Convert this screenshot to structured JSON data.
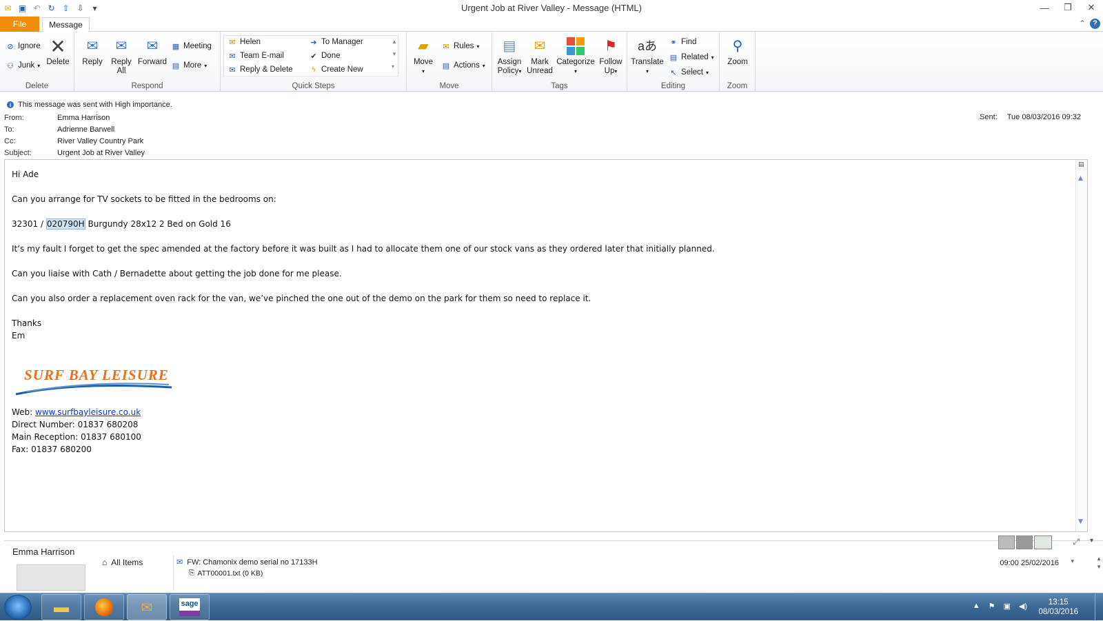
{
  "window": {
    "title": "Urgent Job at River Valley  -  Message (HTML)"
  },
  "tabs": {
    "file": "File",
    "message": "Message"
  },
  "ribbon": {
    "delete_group": {
      "label": "Delete",
      "ignore": "Ignore",
      "junk": "Junk",
      "delete": "Delete"
    },
    "respond_group": {
      "label": "Respond",
      "reply": "Reply",
      "reply_all_1": "Reply",
      "reply_all_2": "All",
      "forward": "Forward",
      "meeting": "Meeting",
      "more": "More"
    },
    "quicksteps_group": {
      "label": "Quick Steps",
      "items": [
        "Helen",
        "To Manager",
        "Team E-mail",
        "Done",
        "Reply & Delete",
        "Create New"
      ]
    },
    "move_group": {
      "label": "Move",
      "move": "Move",
      "rules": "Rules",
      "actions": "Actions"
    },
    "tags_group": {
      "label": "Tags",
      "assign_1": "Assign",
      "assign_2": "Policy",
      "mark_1": "Mark",
      "mark_2": "Unread",
      "categorize": "Categorize",
      "follow_1": "Follow",
      "follow_2": "Up"
    },
    "editing_group": {
      "label": "Editing",
      "translate": "Translate",
      "find": "Find",
      "related": "Related",
      "select": "Select"
    },
    "zoom_group": {
      "label": "Zoom",
      "zoom": "Zoom"
    }
  },
  "header": {
    "importance": "This message was sent with High importance.",
    "from_label": "From:",
    "from": "Emma Harrison",
    "to_label": "To:",
    "to": "Adrienne Barwell",
    "cc_label": "Cc:",
    "cc": "River Valley Country Park",
    "subject_label": "Subject:",
    "subject": "Urgent Job at River Valley",
    "sent_label": "Sent:",
    "sent": "Tue 08/03/2016 09:32"
  },
  "body": {
    "greeting": "Hi Ade",
    "line1": "Can you arrange for TV sockets to be fitted in the bedrooms on:",
    "line2_pre": "32301 / ",
    "line2_hl": "020790H",
    "line2_post": " Burgundy 28x12 2 Bed on Gold 16",
    "line3": "It’s my fault I forget to get the spec amended at the factory before it was built as I had to allocate them one of our stock vans as they ordered later that initially planned.",
    "line4": "Can you liaise with Cath / Bernadette about getting the job done for me please.",
    "line5": "Can you also order a replacement oven rack for the van, we’ve pinched the one out of the demo on the park for them so need to replace it.",
    "thanks": "Thanks",
    "sign": "Em",
    "logo_text": "SURF BAY LEISURE",
    "web_label": "Web: ",
    "web": "www.surfbayleisure.co.uk",
    "direct": "Direct Number:  01837 680208",
    "reception": "Main Reception:  01837 680100",
    "fax": "Fax:  01837 680200"
  },
  "people_pane": {
    "name": "Emma Harrison",
    "all_items": "All Items",
    "item_subject": "FW: Chamonix demo serial no 17133H",
    "item_attachment": "ATT00001.txt (0 KB)",
    "item_date": "09:00  25/02/2016"
  },
  "taskbar": {
    "time": "13:15",
    "date": "08/03/2016",
    "sage": "sage"
  }
}
